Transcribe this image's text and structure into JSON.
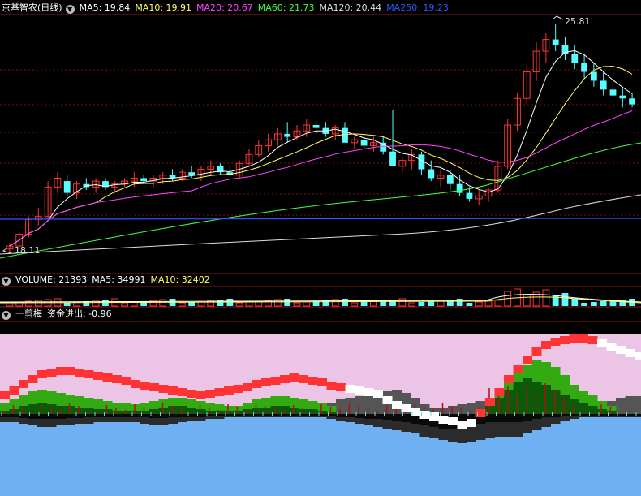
{
  "price_panel": {
    "title": "京基智农(日线)",
    "ma_labels": [
      {
        "text": "MA5: 19.84",
        "color": "#ffffff"
      },
      {
        "text": "MA10: 19.91",
        "color": "#ffff66"
      },
      {
        "text": "MA20: 20.67",
        "color": "#ff44ff"
      },
      {
        "text": "MA60: 21.73",
        "color": "#44ff44"
      },
      {
        "text": "MA120: 20.44",
        "color": "#dddddd"
      },
      {
        "text": "MA250: 19.23",
        "color": "#3355ff"
      }
    ],
    "max_label": "25.81",
    "min_label": "18.11"
  },
  "volume_panel": {
    "labels": [
      {
        "text": "VOLUME: 21393",
        "color": "#ffffff"
      },
      {
        "text": "MA5: 34991",
        "color": "#ffffff"
      },
      {
        "text": "MA10: 32402",
        "color": "#ffff66"
      }
    ]
  },
  "indicator_panel": {
    "labels": [
      {
        "text": "一剪梅",
        "color": "#ffffff"
      },
      {
        "text": "资金进出: -0.96",
        "color": "#ffffff"
      }
    ]
  },
  "colors": {
    "up": "#ff3333",
    "down": "#55ffff",
    "ma5": "#ffffff",
    "ma10": "#ffff66",
    "ma20": "#ff44ff",
    "ma60": "#44ff44",
    "ma120": "#dddddd",
    "ma250": "#3355ff",
    "pink": "#ebc4e6",
    "blue": "#6fb0f2",
    "green": "#33aa11",
    "gray": "#555555"
  },
  "chart_data": {
    "type": "candlestick",
    "y_range": [
      18.11,
      25.81
    ],
    "candles": [
      [
        18.2,
        18.4,
        18.1,
        18.3
      ],
      [
        18.3,
        18.8,
        18.2,
        18.7
      ],
      [
        18.7,
        19.3,
        18.6,
        19.2
      ],
      [
        19.2,
        19.6,
        19.0,
        19.3
      ],
      [
        19.3,
        20.5,
        19.2,
        20.3
      ],
      [
        20.3,
        20.8,
        20.1,
        20.6
      ],
      [
        20.5,
        20.7,
        20.0,
        20.1
      ],
      [
        20.1,
        20.5,
        19.9,
        20.4
      ],
      [
        20.4,
        20.6,
        20.2,
        20.3
      ],
      [
        20.3,
        20.6,
        20.1,
        20.5
      ],
      [
        20.5,
        20.6,
        20.2,
        20.3
      ],
      [
        20.3,
        20.5,
        20.1,
        20.4
      ],
      [
        20.4,
        20.6,
        20.3,
        20.5
      ],
      [
        20.5,
        20.8,
        20.3,
        20.6
      ],
      [
        20.6,
        20.7,
        20.4,
        20.5
      ],
      [
        20.5,
        20.7,
        20.3,
        20.6
      ],
      [
        20.6,
        20.8,
        20.4,
        20.7
      ],
      [
        20.7,
        20.9,
        20.5,
        20.6
      ],
      [
        20.6,
        20.9,
        20.5,
        20.8
      ],
      [
        20.8,
        21.0,
        20.6,
        20.7
      ],
      [
        20.7,
        21.0,
        20.5,
        20.9
      ],
      [
        20.9,
        21.2,
        20.7,
        21.0
      ],
      [
        21.0,
        21.1,
        20.7,
        20.8
      ],
      [
        20.8,
        21.0,
        20.6,
        20.7
      ],
      [
        20.7,
        21.2,
        20.6,
        21.1
      ],
      [
        21.1,
        21.6,
        21.0,
        21.4
      ],
      [
        21.4,
        21.9,
        21.3,
        21.7
      ],
      [
        21.7,
        22.1,
        21.5,
        21.9
      ],
      [
        21.9,
        22.3,
        21.7,
        22.1
      ],
      [
        22.1,
        22.5,
        21.8,
        22.0
      ],
      [
        22.0,
        22.4,
        21.9,
        22.2
      ],
      [
        22.2,
        22.6,
        22.0,
        22.4
      ],
      [
        22.4,
        22.6,
        22.1,
        22.3
      ],
      [
        22.3,
        22.5,
        22.0,
        22.1
      ],
      [
        22.1,
        22.4,
        21.9,
        22.3
      ],
      [
        22.3,
        22.5,
        22.0,
        21.8
      ],
      [
        21.8,
        22.0,
        21.6,
        21.9
      ],
      [
        21.9,
        22.1,
        21.6,
        21.7
      ],
      [
        21.7,
        22.0,
        21.5,
        21.8
      ],
      [
        21.8,
        22.0,
        21.4,
        21.5
      ],
      [
        21.5,
        22.9,
        21.3,
        21.0
      ],
      [
        21.0,
        21.3,
        20.8,
        21.2
      ],
      [
        21.2,
        21.6,
        20.9,
        21.4
      ],
      [
        21.4,
        21.5,
        20.7,
        20.9
      ],
      [
        20.9,
        21.2,
        20.5,
        20.6
      ],
      [
        20.6,
        20.9,
        20.3,
        20.7
      ],
      [
        20.7,
        20.9,
        20.2,
        20.4
      ],
      [
        20.4,
        20.7,
        20.0,
        20.1
      ],
      [
        20.1,
        20.3,
        19.8,
        19.9
      ],
      [
        19.9,
        20.2,
        19.7,
        20.0
      ],
      [
        20.0,
        20.3,
        19.8,
        20.2
      ],
      [
        20.2,
        21.2,
        20.1,
        21.0
      ],
      [
        21.0,
        22.6,
        20.9,
        22.4
      ],
      [
        22.4,
        23.5,
        22.2,
        23.3
      ],
      [
        23.3,
        24.5,
        23.1,
        24.2
      ],
      [
        24.2,
        25.2,
        23.9,
        24.9
      ],
      [
        24.9,
        25.5,
        24.5,
        25.3
      ],
      [
        25.3,
        25.81,
        24.9,
        25.1
      ],
      [
        25.1,
        25.4,
        24.6,
        24.8
      ],
      [
        24.8,
        25.1,
        24.3,
        24.5
      ],
      [
        24.5,
        24.8,
        24.0,
        24.2
      ],
      [
        24.2,
        24.5,
        23.7,
        23.9
      ],
      [
        23.9,
        24.2,
        23.4,
        23.6
      ],
      [
        23.6,
        23.9,
        23.2,
        23.4
      ],
      [
        23.4,
        23.7,
        23.0,
        23.3
      ],
      [
        23.3,
        23.5,
        23.0,
        23.1
      ]
    ]
  }
}
